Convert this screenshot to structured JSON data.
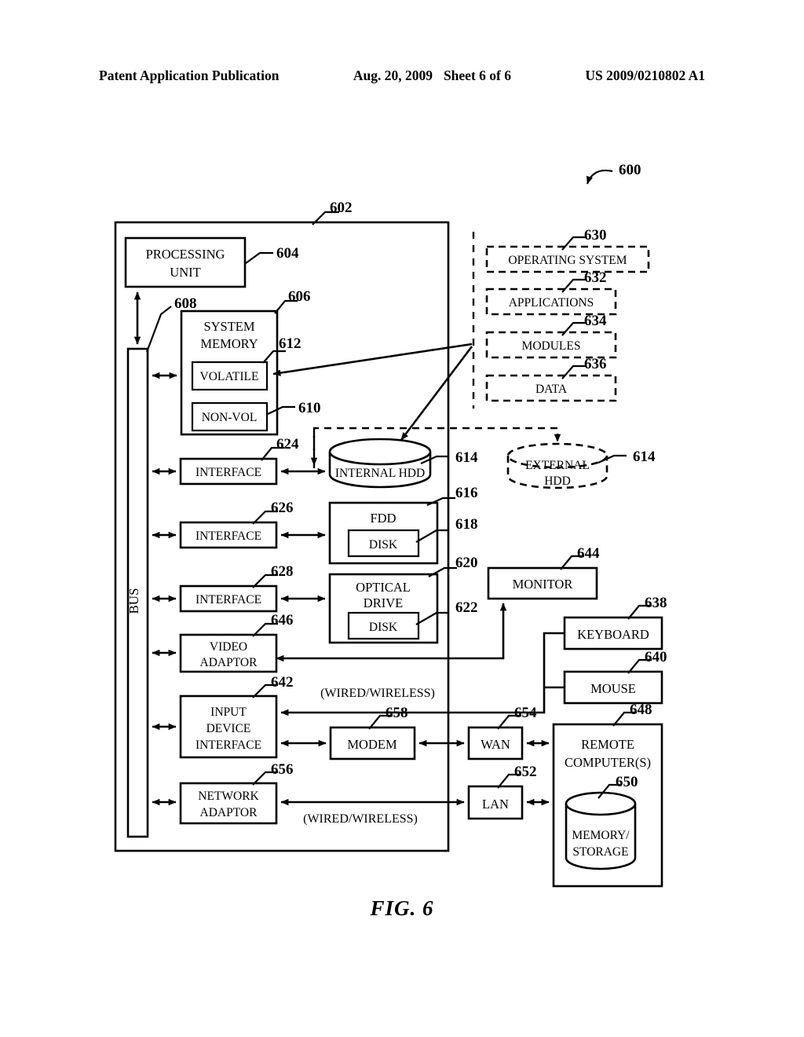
{
  "header": {
    "left": "Patent Application Publication",
    "date": "Aug. 20, 2009",
    "sheet": "Sheet 6 of 6",
    "pubnum": "US 2009/0210802 A1"
  },
  "figure": {
    "caption": "FIG. 6",
    "system_ref": "600"
  },
  "blocks": {
    "computer": {
      "label": "",
      "ref": "602"
    },
    "processing_unit": {
      "label_line1": "PROCESSING",
      "label_line2": "UNIT",
      "ref": "604"
    },
    "bus": {
      "label": "BUS",
      "ref": "608"
    },
    "system_memory": {
      "label_line1": "SYSTEM",
      "label_line2": "MEMORY",
      "ref": "606"
    },
    "volatile": {
      "label": "VOLATILE",
      "ref": "612"
    },
    "nonvol": {
      "label": "NON-VOL",
      "ref": "610"
    },
    "interface_hdd": {
      "label": "INTERFACE",
      "ref": "624"
    },
    "interface_fdd": {
      "label": "INTERFACE",
      "ref": "626"
    },
    "interface_optical": {
      "label": "INTERFACE",
      "ref": "628"
    },
    "video_adaptor": {
      "label_line1": "VIDEO",
      "label_line2": "ADAPTOR",
      "ref": "646"
    },
    "input_device_interface": {
      "label_line1": "INPUT",
      "label_line2": "DEVICE",
      "label_line3": "INTERFACE",
      "ref": "642"
    },
    "network_adaptor": {
      "label_line1": "NETWORK",
      "label_line2": "ADAPTOR",
      "ref": "656"
    },
    "internal_hdd": {
      "label": "INTERNAL HDD",
      "ref": "614"
    },
    "external_hdd": {
      "label_line1": "EXTERNAL",
      "label_line2": "HDD",
      "ref": "614"
    },
    "fdd": {
      "label": "FDD",
      "ref": "616"
    },
    "fdd_disk": {
      "label": "DISK",
      "ref": "618"
    },
    "optical_drive": {
      "label_line1": "OPTICAL",
      "label_line2": "DRIVE",
      "ref": "620"
    },
    "optical_disk": {
      "label": "DISK",
      "ref": "622"
    },
    "monitor": {
      "label": "MONITOR",
      "ref": "644"
    },
    "keyboard": {
      "label": "KEYBOARD",
      "ref": "638"
    },
    "mouse": {
      "label": "MOUSE",
      "ref": "640"
    },
    "modem": {
      "label": "MODEM",
      "ref": "658"
    },
    "wan": {
      "label": "WAN",
      "ref": "654"
    },
    "lan": {
      "label": "LAN",
      "ref": "652"
    },
    "remote_computers": {
      "label_line1": "REMOTE",
      "label_line2": "COMPUTER(S)",
      "ref": "648"
    },
    "memory_storage": {
      "label_line1": "MEMORY/",
      "label_line2": "STORAGE",
      "ref": "650"
    },
    "operating_system": {
      "label": "OPERATING SYSTEM",
      "ref": "630"
    },
    "applications": {
      "label": "APPLICATIONS",
      "ref": "632"
    },
    "modules": {
      "label": "MODULES",
      "ref": "634"
    },
    "data_block": {
      "label": "DATA",
      "ref": "636"
    }
  },
  "annotations": {
    "wired_wireless_top": "(WIRED/WIRELESS)",
    "wired_wireless_bottom": "(WIRED/WIRELESS)"
  }
}
